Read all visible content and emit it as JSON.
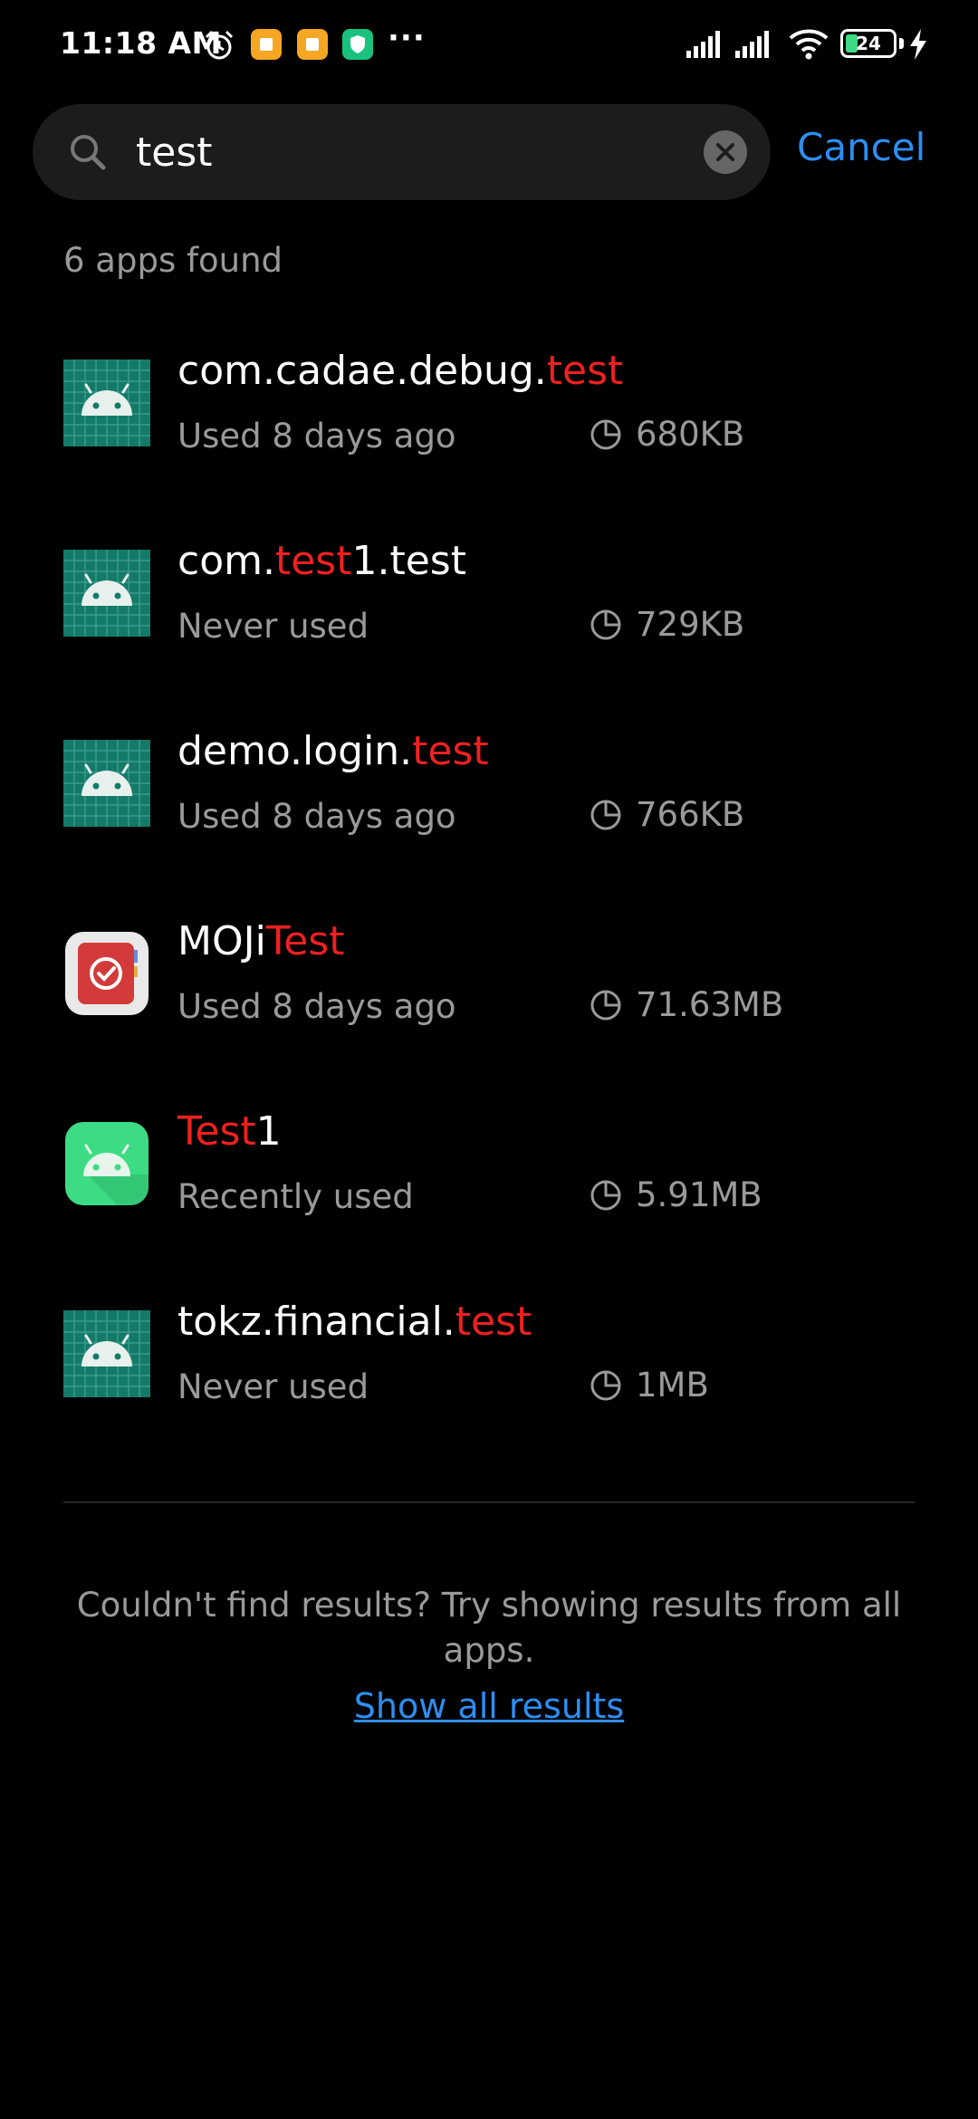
{
  "status_bar": {
    "time": "11:18 AM",
    "more": "···",
    "battery": "24",
    "icons": [
      "alarm-icon",
      "app-notification-icon",
      "app-notification-icon",
      "shield-icon",
      "signal-icon",
      "signal-icon",
      "wifi-icon",
      "battery-icon",
      "charging-icon"
    ]
  },
  "search": {
    "value": "test",
    "cancel_label": "Cancel"
  },
  "results_count": "6 apps found",
  "apps": [
    {
      "name_parts": [
        "com.cadae.debug.",
        "test",
        ""
      ],
      "usage": "Used 8 days ago",
      "size": "680KB",
      "icon": "android-grid-icon"
    },
    {
      "name_parts": [
        "com.",
        "test",
        "1.test"
      ],
      "usage": "Never used",
      "size": "729KB",
      "icon": "android-grid-icon"
    },
    {
      "name_parts": [
        "demo.login.",
        "test",
        ""
      ],
      "usage": "Used 8 days ago",
      "size": "766KB",
      "icon": "android-grid-icon"
    },
    {
      "name_parts": [
        "MOJi",
        "Test",
        ""
      ],
      "usage": "Used 8 days ago",
      "size": "71.63MB",
      "icon": "moji-checklist-icon"
    },
    {
      "name_parts": [
        "",
        "Test",
        "1"
      ],
      "usage": "Recently used",
      "size": "5.91MB",
      "icon": "android-green-icon"
    },
    {
      "name_parts": [
        "tokz.financial.",
        "test",
        ""
      ],
      "usage": "Never used",
      "size": "1MB",
      "icon": "android-grid-icon"
    }
  ],
  "hint": "Couldn't find results? Try showing results from all apps.",
  "show_all_label": "Show all results",
  "colors": {
    "accent": "#2d8ef2",
    "highlight": "#ef2020",
    "muted": "#9a9a9a",
    "background": "#000000"
  }
}
